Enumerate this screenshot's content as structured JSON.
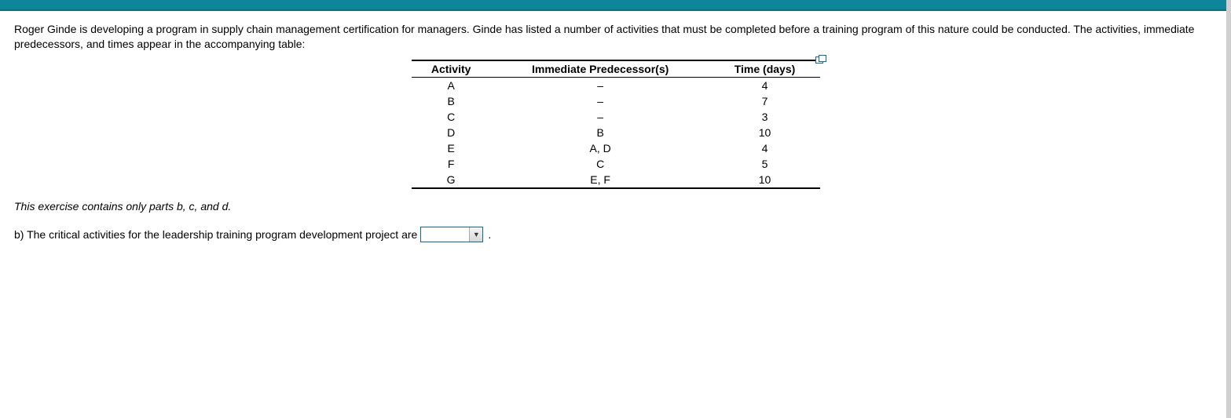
{
  "problem_text": "Roger Ginde is developing a program in supply chain management certification for managers. Ginde has listed a number of activities that must be completed before a training program of this nature could be conducted. The activities, immediate predecessors, and times appear in the accompanying table:",
  "table": {
    "headers": {
      "c1": "Activity",
      "c2": "Immediate Predecessor(s)",
      "c3": "Time (days)"
    },
    "rows": [
      {
        "activity": "A",
        "pred": "–",
        "time": "4"
      },
      {
        "activity": "B",
        "pred": "–",
        "time": "7"
      },
      {
        "activity": "C",
        "pred": "–",
        "time": "3"
      },
      {
        "activity": "D",
        "pred": "B",
        "time": "10"
      },
      {
        "activity": "E",
        "pred": "A, D",
        "time": "4"
      },
      {
        "activity": "F",
        "pred": "C",
        "time": "5"
      },
      {
        "activity": "G",
        "pred": "E, F",
        "time": "10"
      }
    ]
  },
  "note": "This exercise contains only parts b, c, and d.",
  "question_b": "b) The critical activities for the leadership training program development project are",
  "period": "."
}
